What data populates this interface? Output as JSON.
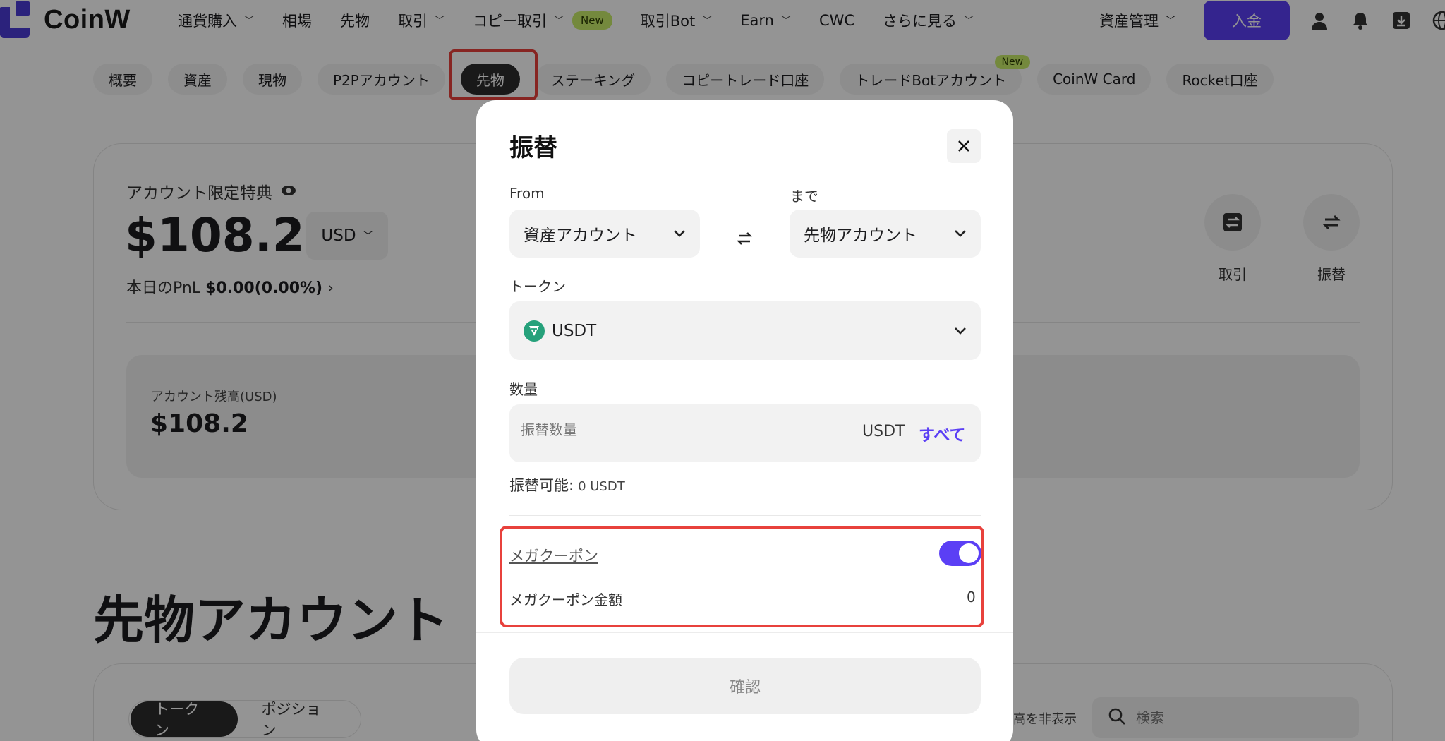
{
  "header": {
    "logo_text": "CoinW",
    "nav": [
      {
        "label": "通貨購入",
        "chevron": true
      },
      {
        "label": "相場",
        "chevron": false
      },
      {
        "label": "先物",
        "chevron": false
      },
      {
        "label": "取引",
        "chevron": true
      },
      {
        "label": "コピー取引",
        "chevron": true,
        "badge": "New"
      },
      {
        "label": "取引Bot",
        "chevron": true
      },
      {
        "label": "Earn",
        "chevron": true
      },
      {
        "label": "CWC",
        "chevron": false
      },
      {
        "label": "さらに見る",
        "chevron": true
      }
    ],
    "asset_management": "資産管理",
    "deposit": "入金",
    "icons": [
      "user-icon",
      "bell-icon",
      "download-icon",
      "globe-icon"
    ]
  },
  "subtabs": [
    {
      "label": "概要"
    },
    {
      "label": "資産"
    },
    {
      "label": "現物"
    },
    {
      "label": "P2Pアカウント"
    },
    {
      "label": "先物",
      "active": true
    },
    {
      "label": "ステーキング"
    },
    {
      "label": "コピートレード口座"
    },
    {
      "label": "トレードBotアカウント",
      "badge": "New"
    },
    {
      "label": "CoinW Card"
    },
    {
      "label": "Rocket口座"
    }
  ],
  "account": {
    "label": "アカウント限定特典",
    "value": "$108.2",
    "currency": "USD",
    "pnl_label": "本日のPnL",
    "pnl_value": "$0.00(0.00%)",
    "balance_label": "アカウント残高(USD)",
    "balance_value": "$108.2",
    "actions": [
      {
        "label": "取引",
        "icon": "trade-icon"
      },
      {
        "label": "振替",
        "icon": "transfer-icon"
      }
    ]
  },
  "section_title": "先物アカウント",
  "list": {
    "tabs": [
      {
        "label": "トークン",
        "active": true
      },
      {
        "label": "ポジション"
      }
    ],
    "hide_small_text": "残高を非表示",
    "search_placeholder": "検索"
  },
  "modal": {
    "title": "振替",
    "from_label": "From",
    "to_label": "まで",
    "from_value": "資産アカウント",
    "to_value": "先物アカウント",
    "token_label": "トークン",
    "token_value": "USDT",
    "amount_label": "数量",
    "amount_placeholder": "振替数量",
    "amount_unit": "USDT",
    "amount_all": "すべて",
    "available_label": "振替可能:",
    "available_value": "0 USDT",
    "coupon_label": "メガクーポン",
    "coupon_enabled": true,
    "coupon_amount_label": "メガクーポン金額",
    "coupon_amount_value": "0",
    "confirm": "確認"
  },
  "colors": {
    "accent": "#5b3ff5",
    "highlight": "#e8413c",
    "new_badge": "#c9ec6a",
    "tether": "#26a17b"
  }
}
